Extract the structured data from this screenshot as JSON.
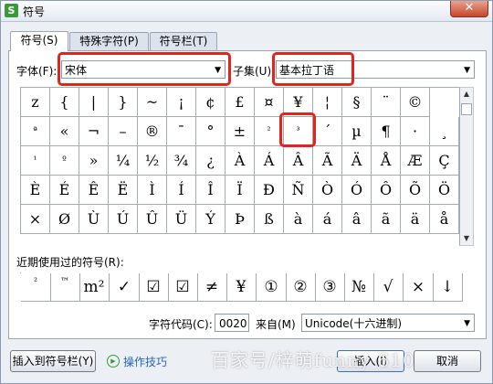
{
  "window": {
    "title": "符号",
    "close_label": "✕"
  },
  "tabs": [
    {
      "label": "符号(S)",
      "active": true
    },
    {
      "label": "特殊字符(P)",
      "active": false
    },
    {
      "label": "符号栏(T)",
      "active": false
    }
  ],
  "font": {
    "label": "字体(F):",
    "value": "宋体"
  },
  "subset": {
    "label": "子集(U):",
    "value": "基本拉丁语"
  },
  "symbols": [
    [
      "z",
      "{",
      "|",
      "}",
      "~",
      "¡",
      "¢",
      "£",
      "¤",
      "¥",
      "¦",
      "§",
      "¨",
      "©"
    ],
    [
      "ª",
      "«",
      "¬",
      "–",
      "®",
      "¯",
      "°",
      "±",
      "²",
      "³",
      "´",
      "µ",
      "¶",
      "·",
      "¸"
    ],
    [
      "¹",
      "º",
      "»",
      "¼",
      "½",
      "¾",
      "¿",
      "À",
      "Á",
      "Â",
      "Ã",
      "Ä",
      "Å",
      "Æ",
      "Ç"
    ],
    [
      "È",
      "É",
      "Ê",
      "Ë",
      "Ì",
      "Í",
      "Î",
      "Ï",
      "Ð",
      "Ñ",
      "Ò",
      "Ó",
      "Ô",
      "Õ",
      "Ö"
    ],
    [
      "×",
      "Ø",
      "Ù",
      "Ú",
      "Û",
      "Ü",
      "Ý",
      "Þ",
      "ß",
      "à",
      "á",
      "â",
      "ã",
      "ä",
      "å"
    ]
  ],
  "recent": {
    "label": "近期使用过的符号(R):",
    "items": [
      "²",
      "™",
      "m²",
      "✓",
      "☑",
      "☑",
      "≠",
      "¥",
      "①",
      "②",
      "③",
      "№",
      "√",
      "×",
      "↓"
    ]
  },
  "charcode": {
    "label": "字符代码(C):",
    "value": "0020",
    "from_label": "来自(M)",
    "from_value": "Unicode(十六进制)"
  },
  "buttons": {
    "insert_to_bar": "插入到符号栏(Y)",
    "tips": "操作技巧",
    "insert": "插入(I)",
    "cancel": "取消"
  },
  "watermark": "百家号/梓萌funny 610",
  "colors": {
    "highlight": "#e5231d",
    "link": "#2a64b4"
  }
}
